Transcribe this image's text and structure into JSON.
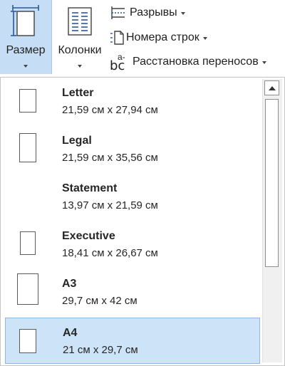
{
  "ribbon": {
    "size_button": {
      "label": "Размер",
      "icon": "page-size-icon"
    },
    "columns_button": {
      "label": "Колонки",
      "icon": "columns-icon"
    },
    "breaks_button": {
      "label": "Разрывы",
      "icon": "breaks-icon"
    },
    "line_numbers_button": {
      "label": "Номера строк",
      "icon": "line-numbers-icon"
    },
    "hyphenation_button": {
      "label": "Расстановка переносов",
      "icon": "hyphenation-icon",
      "icon_text": "bc",
      "icon_text_sup": "a-"
    }
  },
  "size_menu": {
    "items": [
      {
        "name": "Letter",
        "dims": "21,59 см x 27,94 см",
        "selected": false
      },
      {
        "name": "Legal",
        "dims": "21,59 см x 35,56 см",
        "selected": false
      },
      {
        "name": "Statement",
        "dims": "13,97 см x 21,59 см",
        "selected": false
      },
      {
        "name": "Executive",
        "dims": "18,41 см x 26,67 см",
        "selected": false
      },
      {
        "name": "A3",
        "dims": "29,7 см x 42 см",
        "selected": false
      },
      {
        "name": "A4",
        "dims": "21 см x 29,7 см",
        "selected": true
      }
    ]
  },
  "colors": {
    "selected_bg": "#cde3f7",
    "active_button_bg": "#c5def5",
    "accent": "#2b579a"
  }
}
